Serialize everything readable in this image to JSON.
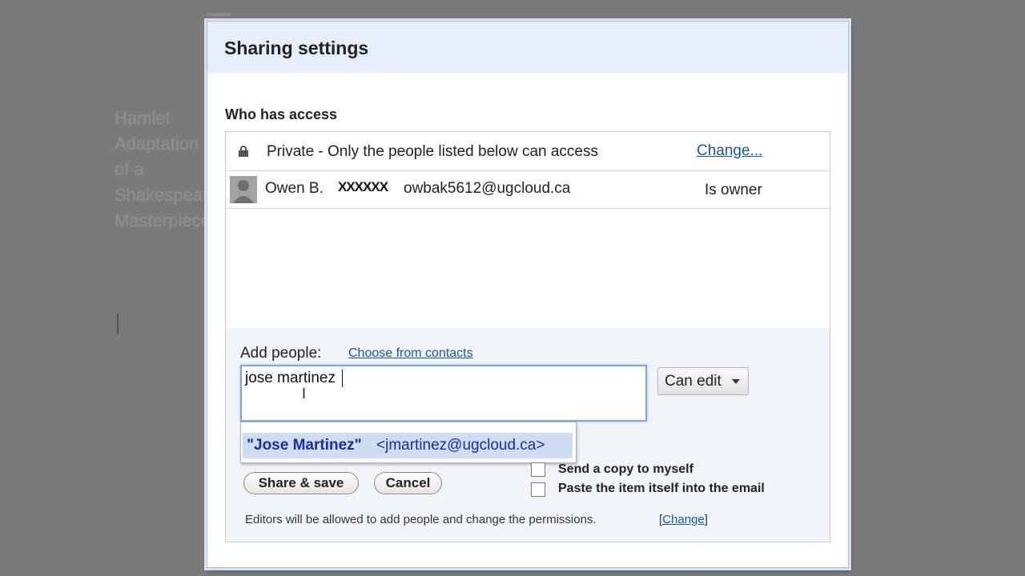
{
  "background": {
    "doc_lines": [
      "Hamlet",
      "Adaptation",
      "of a",
      "Shakespeare",
      "Masterpiece"
    ]
  },
  "dialog": {
    "title": "Sharing settings",
    "who_has_access": "Who has access",
    "private_row": {
      "icon": "lock-icon",
      "text": "Private - Only the people listed below can access",
      "change_link": "Change..."
    },
    "owner_row": {
      "name": "Owen B.",
      "redacted": "XXXXXX",
      "email": "owbak5612@ugcloud.ca",
      "role": "Is owner"
    },
    "add_people": {
      "label": "Add people:",
      "choose_link": "Choose from contacts",
      "input_value": "jose martinez",
      "permission": "Can edit"
    },
    "suggestion": {
      "name": "\"Jose Martinez\"",
      "email": "<jmartinez@ugcloud.ca>"
    },
    "options": {
      "send_copy": "Send a copy to myself",
      "paste_item": "Paste the item itself into the email"
    },
    "buttons": {
      "share_save": "Share & save",
      "cancel": "Cancel"
    },
    "footer": {
      "note": "Editors will be allowed to add people and change the permissions.",
      "change_link": "Change"
    }
  }
}
